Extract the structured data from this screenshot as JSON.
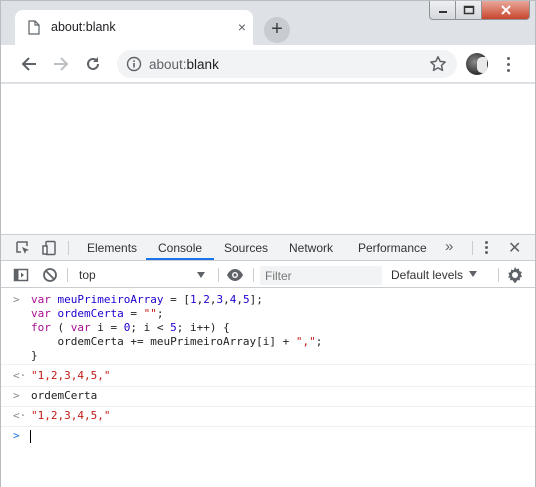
{
  "browser": {
    "tab_title": "about:blank",
    "tab_close": "×",
    "new_tab": "+",
    "url_scheme": "about:",
    "url_rest": "blank"
  },
  "devtools": {
    "tabs": [
      "Elements",
      "Console",
      "Sources",
      "Network",
      "Performance"
    ],
    "active_tab": "Console",
    "more_tabs": "»",
    "close": "✕",
    "context": "top",
    "filter_placeholder": "Filter",
    "filter_value": "",
    "levels": "Default levels"
  },
  "console": {
    "input1": {
      "l1": [
        "var",
        " meuPrimeiroArray",
        " = [",
        "1",
        ",",
        "2",
        ",",
        "3",
        ",",
        "4",
        ",",
        "5",
        "];"
      ],
      "l2": [
        "var",
        " ordemCerta",
        " = ",
        "\"\"",
        ";"
      ],
      "l3": [
        "for",
        " ( ",
        "var",
        " i = ",
        "0",
        "; i < ",
        "5",
        "; i++) {"
      ],
      "l4": [
        "    ordemCerta += meuPrimeiroArray[i] + ",
        "\",\"",
        ";"
      ],
      "l5": "}"
    },
    "output1": "\"1,2,3,4,5,\"",
    "input2": "ordemCerta",
    "output2": "\"1,2,3,4,5,\"",
    "prompt_in": ">",
    "prompt_out": "<·"
  }
}
